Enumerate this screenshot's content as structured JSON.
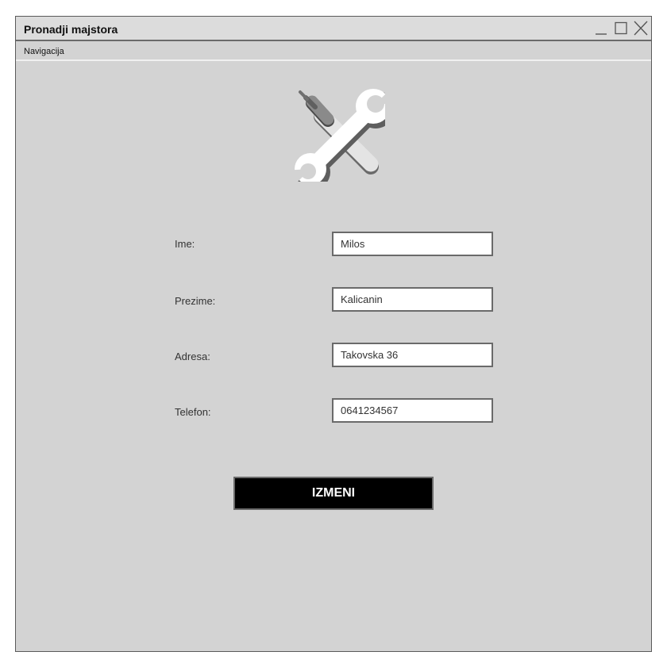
{
  "window": {
    "title": "Pronadji majstora",
    "controls": [
      {
        "name": "minimize",
        "icon": "minimize-icon"
      },
      {
        "name": "maximize",
        "icon": "maximize-icon"
      },
      {
        "name": "close",
        "icon": "close-icon"
      }
    ]
  },
  "menu": {
    "items": [
      {
        "label": "Navigacija"
      }
    ]
  },
  "logo": {
    "icon": "tools-icon"
  },
  "form": {
    "fields": [
      {
        "label": "Ime:",
        "value": "Milos"
      },
      {
        "label": "Prezime:",
        "value": "Kalicanin"
      },
      {
        "label": "Adresa:",
        "value": "Takovska 36"
      },
      {
        "label": "Telefon:",
        "value": "0641234567"
      }
    ],
    "submit_label": "IZMENI"
  },
  "colors": {
    "window_background": "#d3d3d3",
    "titlebar_background": "#dcdcdc",
    "border": "#6a6a6a",
    "button_background": "#000000",
    "button_text": "#ffffff"
  }
}
